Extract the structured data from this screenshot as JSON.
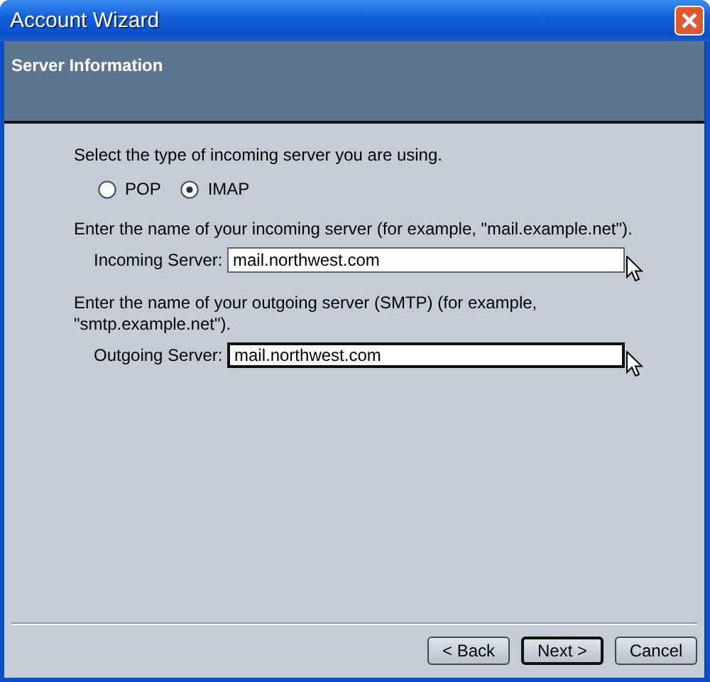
{
  "window": {
    "title": "Account Wizard"
  },
  "header": {
    "title": "Server Information"
  },
  "server_type": {
    "prompt": "Select the type of incoming server you are using.",
    "options": [
      {
        "label": "POP",
        "selected": false
      },
      {
        "label": "IMAP",
        "selected": true
      }
    ]
  },
  "servers": [
    {
      "prompt": "Enter the name of your incoming server (for example, \"mail.example.net\").",
      "label": "Incoming Server:",
      "value": "mail.northwest.com"
    },
    {
      "prompt": "Enter the name of your outgoing server (SMTP) (for example, \"smtp.example.net\").",
      "label": "Outgoing Server:",
      "value": "mail.northwest.com"
    }
  ],
  "buttons": [
    {
      "label": "< Back",
      "default": false
    },
    {
      "label": "Next >",
      "default": true
    },
    {
      "label": "Cancel",
      "default": false
    }
  ]
}
